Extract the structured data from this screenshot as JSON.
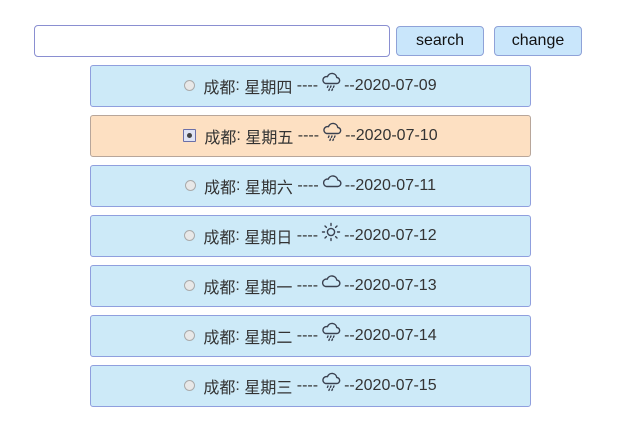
{
  "search": {
    "placeholder": "",
    "value": ""
  },
  "toolbar": {
    "search_label": "search",
    "change_label": "change"
  },
  "forecast": [
    {
      "city": "成都",
      "weekday": "星期四",
      "sep": " ----",
      "icon": "rain",
      "date": "--2020-07-09",
      "selected": false
    },
    {
      "city": "成都",
      "weekday": "星期五",
      "sep": " ----",
      "icon": "rain",
      "date": "--2020-07-10",
      "selected": true
    },
    {
      "city": "成都",
      "weekday": "星期六",
      "sep": " ----",
      "icon": "cloud",
      "date": "--2020-07-11",
      "selected": false
    },
    {
      "city": "成都",
      "weekday": "星期日",
      "sep": " ----",
      "icon": "sun",
      "date": "--2020-07-12",
      "selected": false
    },
    {
      "city": "成都",
      "weekday": "星期一",
      "sep": " ----",
      "icon": "cloud",
      "date": "--2020-07-13",
      "selected": false
    },
    {
      "city": "成都",
      "weekday": "星期二",
      "sep": " ----",
      "icon": "rain",
      "date": "--2020-07-14",
      "selected": false
    },
    {
      "city": "成都",
      "weekday": "星期三",
      "sep": " ----",
      "icon": "rain",
      "date": "--2020-07-15",
      "selected": false
    }
  ],
  "colors": {
    "item_bg": "#cdeaf8",
    "item_selected_bg": "#fde0c2",
    "button_bg": "#c9e6fb",
    "border": "#8f9fde"
  }
}
